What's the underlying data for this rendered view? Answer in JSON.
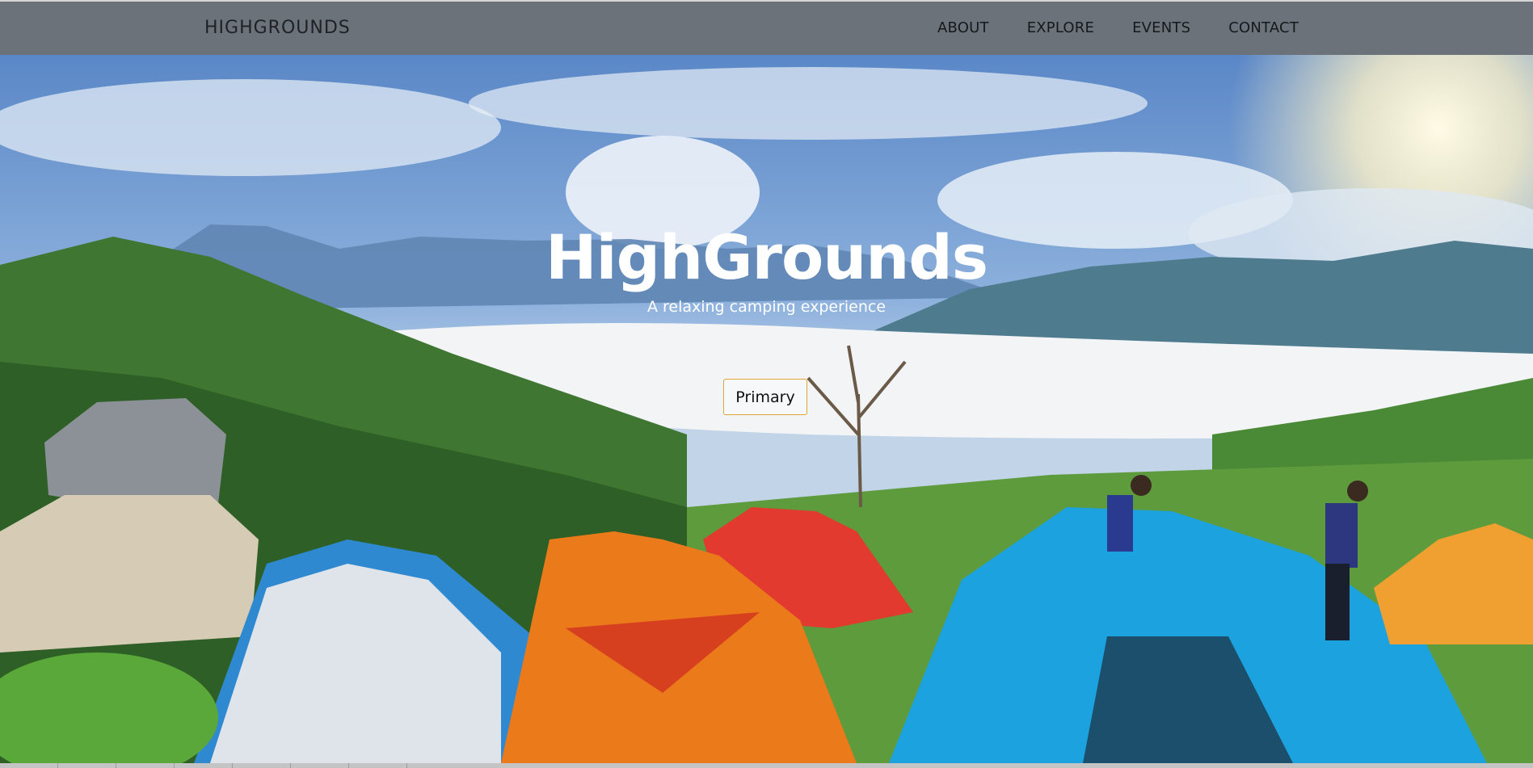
{
  "nav": {
    "brand": "HIGHGROUNDS",
    "links": [
      "ABOUT",
      "EXPLORE",
      "EVENTS",
      "CONTACT"
    ]
  },
  "hero": {
    "title": "HighGrounds",
    "subtitle": "A relaxing camping experience",
    "button_label": "Primary"
  },
  "colors": {
    "navbar": "#6c7279",
    "button_border": "#e0a437",
    "text_light": "#ffffff"
  }
}
